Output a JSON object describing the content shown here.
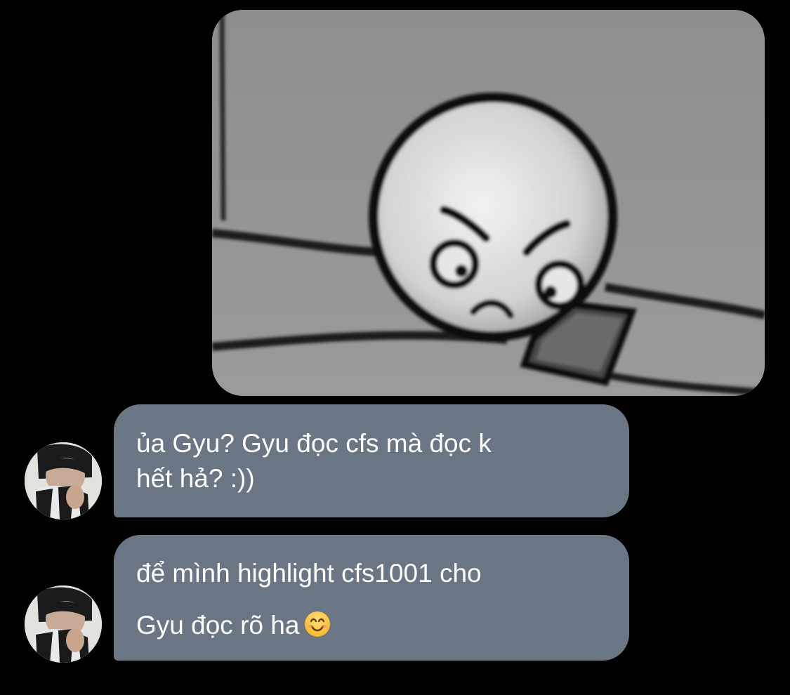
{
  "conversation": {
    "shared_image": {
      "description_icon": "angry-cartoon-face-image"
    },
    "messages": [
      {
        "line1": "ủa Gyu? Gyu đọc cfs mà đọc k",
        "line2": "hết hả? :))"
      },
      {
        "line1": "để mình highlight cfs1001 cho",
        "line2": "Gyu đọc rõ ha",
        "emoji": "smiling-face-emoji"
      }
    ],
    "avatar_icon": "user-avatar-photo"
  },
  "colors": {
    "background": "#000000",
    "incoming_bubble": "#6b7684",
    "bubble_text": "#ffffff"
  }
}
